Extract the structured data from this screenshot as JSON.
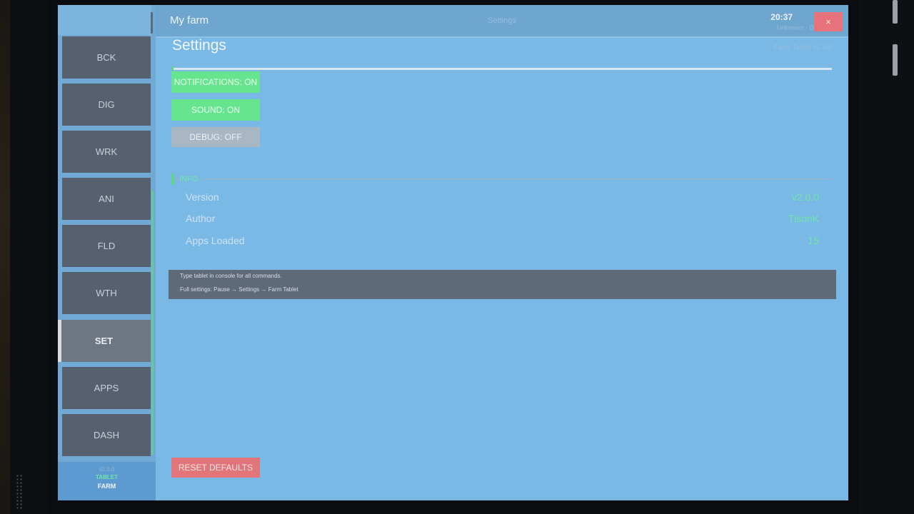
{
  "header": {
    "title": "My farm",
    "center_title": "Settings",
    "time": "20:37",
    "weather": "Unknown · Day 21",
    "close_label": "×"
  },
  "sidebar": {
    "items": [
      {
        "label": "BCK",
        "active": false
      },
      {
        "label": "DIG",
        "active": false
      },
      {
        "label": "WRK",
        "active": false
      },
      {
        "label": "ANI",
        "active": false
      },
      {
        "label": "FLD",
        "active": false
      },
      {
        "label": "WTH",
        "active": false
      },
      {
        "label": "SET",
        "active": true
      },
      {
        "label": "APPS",
        "active": false
      },
      {
        "label": "DASH",
        "active": false
      }
    ],
    "brand": {
      "line1": "v2.0.0",
      "line2": "TABLET",
      "line3": "FARM"
    }
  },
  "settings": {
    "title": "Settings",
    "version_caption": "Farm Tablet v2.0.0",
    "toggles": [
      {
        "label": "NOTIFICATIONS: ON",
        "state": "on"
      },
      {
        "label": "SOUND: ON",
        "state": "on"
      },
      {
        "label": "DEBUG: OFF",
        "state": "off"
      }
    ],
    "info_section_label": "INFO",
    "info": [
      {
        "key": "Version",
        "value": "v2.0.0"
      },
      {
        "key": "Author",
        "value": "TisonK"
      },
      {
        "key": "Apps Loaded",
        "value": "15"
      }
    ],
    "help_lines": [
      "Type  tablet  in console for all commands.",
      "Full settings: Pause → Settings → Farm Tablet"
    ],
    "reset_label": "RESET DEFAULTS"
  },
  "colors": {
    "screen_bg": "#7ab9e6",
    "toggle_on": "#67e58e",
    "toggle_off": "#a9b6c3",
    "reset": "#e17579",
    "close": "#e7737a",
    "accent_green": "#6fe6a8"
  }
}
